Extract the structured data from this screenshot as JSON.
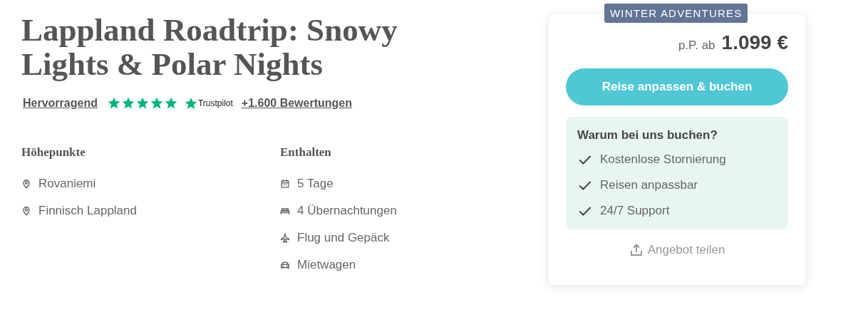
{
  "title": "Lappland Roadtrip: Snowy Lights & Polar Nights",
  "rating": {
    "label": "Hervorragend",
    "stars": 5,
    "brand": "Trustpilot",
    "reviews": "+1.600 Bewertungen"
  },
  "sections": [
    {
      "heading": "Höhepunkte",
      "items": [
        {
          "kind": "location",
          "text": "Rovaniemi"
        },
        {
          "kind": "location",
          "text": "Finnisch Lappland"
        }
      ]
    },
    {
      "heading": "Enthalten",
      "items": [
        {
          "kind": "calendar",
          "text": "5 Tage"
        },
        {
          "kind": "bed",
          "text": "4 Übernachtungen"
        },
        {
          "kind": "plane",
          "text": "Flug und Gepäck"
        },
        {
          "kind": "car",
          "text": "Mietwagen"
        }
      ]
    }
  ],
  "card": {
    "badge": "WINTER ADVENTURES",
    "price_prefix": "p.P. ab",
    "price": "1.099 €",
    "button": "Reise anpassen & buchen",
    "benefits_title": "Warum bei uns buchen?",
    "benefits": [
      "Kostenlose Stornierung",
      "Reisen anpassbar",
      "24/7 Support"
    ],
    "share": "Angebot teilen"
  }
}
